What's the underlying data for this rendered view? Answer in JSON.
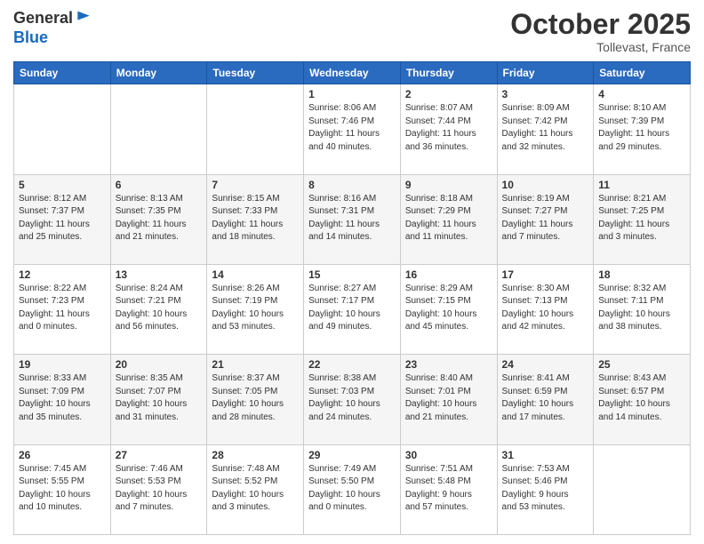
{
  "header": {
    "logo_line1": "General",
    "logo_line2": "Blue",
    "month": "October 2025",
    "location": "Tollevast, France"
  },
  "days_of_week": [
    "Sunday",
    "Monday",
    "Tuesday",
    "Wednesday",
    "Thursday",
    "Friday",
    "Saturday"
  ],
  "weeks": [
    [
      {
        "day": "",
        "info": ""
      },
      {
        "day": "",
        "info": ""
      },
      {
        "day": "",
        "info": ""
      },
      {
        "day": "1",
        "info": "Sunrise: 8:06 AM\nSunset: 7:46 PM\nDaylight: 11 hours\nand 40 minutes."
      },
      {
        "day": "2",
        "info": "Sunrise: 8:07 AM\nSunset: 7:44 PM\nDaylight: 11 hours\nand 36 minutes."
      },
      {
        "day": "3",
        "info": "Sunrise: 8:09 AM\nSunset: 7:42 PM\nDaylight: 11 hours\nand 32 minutes."
      },
      {
        "day": "4",
        "info": "Sunrise: 8:10 AM\nSunset: 7:39 PM\nDaylight: 11 hours\nand 29 minutes."
      }
    ],
    [
      {
        "day": "5",
        "info": "Sunrise: 8:12 AM\nSunset: 7:37 PM\nDaylight: 11 hours\nand 25 minutes."
      },
      {
        "day": "6",
        "info": "Sunrise: 8:13 AM\nSunset: 7:35 PM\nDaylight: 11 hours\nand 21 minutes."
      },
      {
        "day": "7",
        "info": "Sunrise: 8:15 AM\nSunset: 7:33 PM\nDaylight: 11 hours\nand 18 minutes."
      },
      {
        "day": "8",
        "info": "Sunrise: 8:16 AM\nSunset: 7:31 PM\nDaylight: 11 hours\nand 14 minutes."
      },
      {
        "day": "9",
        "info": "Sunrise: 8:18 AM\nSunset: 7:29 PM\nDaylight: 11 hours\nand 11 minutes."
      },
      {
        "day": "10",
        "info": "Sunrise: 8:19 AM\nSunset: 7:27 PM\nDaylight: 11 hours\nand 7 minutes."
      },
      {
        "day": "11",
        "info": "Sunrise: 8:21 AM\nSunset: 7:25 PM\nDaylight: 11 hours\nand 3 minutes."
      }
    ],
    [
      {
        "day": "12",
        "info": "Sunrise: 8:22 AM\nSunset: 7:23 PM\nDaylight: 11 hours\nand 0 minutes."
      },
      {
        "day": "13",
        "info": "Sunrise: 8:24 AM\nSunset: 7:21 PM\nDaylight: 10 hours\nand 56 minutes."
      },
      {
        "day": "14",
        "info": "Sunrise: 8:26 AM\nSunset: 7:19 PM\nDaylight: 10 hours\nand 53 minutes."
      },
      {
        "day": "15",
        "info": "Sunrise: 8:27 AM\nSunset: 7:17 PM\nDaylight: 10 hours\nand 49 minutes."
      },
      {
        "day": "16",
        "info": "Sunrise: 8:29 AM\nSunset: 7:15 PM\nDaylight: 10 hours\nand 45 minutes."
      },
      {
        "day": "17",
        "info": "Sunrise: 8:30 AM\nSunset: 7:13 PM\nDaylight: 10 hours\nand 42 minutes."
      },
      {
        "day": "18",
        "info": "Sunrise: 8:32 AM\nSunset: 7:11 PM\nDaylight: 10 hours\nand 38 minutes."
      }
    ],
    [
      {
        "day": "19",
        "info": "Sunrise: 8:33 AM\nSunset: 7:09 PM\nDaylight: 10 hours\nand 35 minutes."
      },
      {
        "day": "20",
        "info": "Sunrise: 8:35 AM\nSunset: 7:07 PM\nDaylight: 10 hours\nand 31 minutes."
      },
      {
        "day": "21",
        "info": "Sunrise: 8:37 AM\nSunset: 7:05 PM\nDaylight: 10 hours\nand 28 minutes."
      },
      {
        "day": "22",
        "info": "Sunrise: 8:38 AM\nSunset: 7:03 PM\nDaylight: 10 hours\nand 24 minutes."
      },
      {
        "day": "23",
        "info": "Sunrise: 8:40 AM\nSunset: 7:01 PM\nDaylight: 10 hours\nand 21 minutes."
      },
      {
        "day": "24",
        "info": "Sunrise: 8:41 AM\nSunset: 6:59 PM\nDaylight: 10 hours\nand 17 minutes."
      },
      {
        "day": "25",
        "info": "Sunrise: 8:43 AM\nSunset: 6:57 PM\nDaylight: 10 hours\nand 14 minutes."
      }
    ],
    [
      {
        "day": "26",
        "info": "Sunrise: 7:45 AM\nSunset: 5:55 PM\nDaylight: 10 hours\nand 10 minutes."
      },
      {
        "day": "27",
        "info": "Sunrise: 7:46 AM\nSunset: 5:53 PM\nDaylight: 10 hours\nand 7 minutes."
      },
      {
        "day": "28",
        "info": "Sunrise: 7:48 AM\nSunset: 5:52 PM\nDaylight: 10 hours\nand 3 minutes."
      },
      {
        "day": "29",
        "info": "Sunrise: 7:49 AM\nSunset: 5:50 PM\nDaylight: 10 hours\nand 0 minutes."
      },
      {
        "day": "30",
        "info": "Sunrise: 7:51 AM\nSunset: 5:48 PM\nDaylight: 9 hours\nand 57 minutes."
      },
      {
        "day": "31",
        "info": "Sunrise: 7:53 AM\nSunset: 5:46 PM\nDaylight: 9 hours\nand 53 minutes."
      },
      {
        "day": "",
        "info": ""
      }
    ]
  ]
}
